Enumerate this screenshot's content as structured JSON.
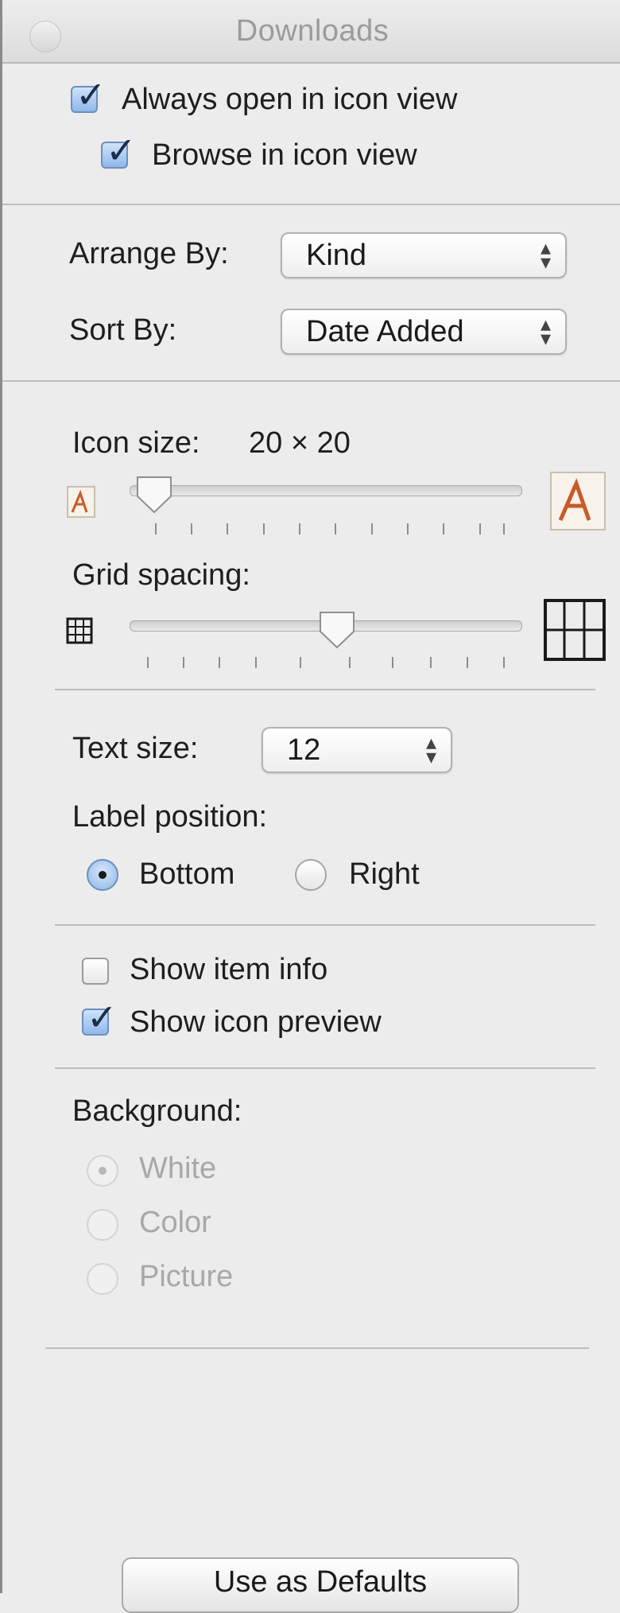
{
  "window": {
    "title": "Downloads"
  },
  "view_options": {
    "always_open_icon_view": {
      "label": "Always open in icon view",
      "checked": true
    },
    "browse_icon_view": {
      "label": "Browse in icon view",
      "checked": true
    }
  },
  "arrange": {
    "arrange_by_label": "Arrange By:",
    "arrange_by_value": "Kind",
    "sort_by_label": "Sort By:",
    "sort_by_value": "Date Added"
  },
  "icon_size": {
    "label": "Icon size:",
    "value": "20 × 20",
    "level": 0.0,
    "small_icon": "pdf-preview-icon-small",
    "large_icon": "pdf-preview-icon-large"
  },
  "grid_spacing": {
    "label": "Grid spacing:",
    "level": 0.5,
    "small_icon": "grid-icon-small",
    "large_icon": "grid-icon-large"
  },
  "text": {
    "text_size_label": "Text size:",
    "text_size_value": "12",
    "label_position_label": "Label position:",
    "bottom_label": "Bottom",
    "right_label": "Right",
    "selected": "Bottom"
  },
  "item_options": {
    "show_item_info": {
      "label": "Show item info",
      "checked": false
    },
    "show_icon_preview": {
      "label": "Show icon preview",
      "checked": true
    }
  },
  "background": {
    "label": "Background:",
    "options": [
      "White",
      "Color",
      "Picture"
    ],
    "selected": "White",
    "enabled": false
  },
  "footer": {
    "use_as_defaults_label": "Use as Defaults"
  }
}
